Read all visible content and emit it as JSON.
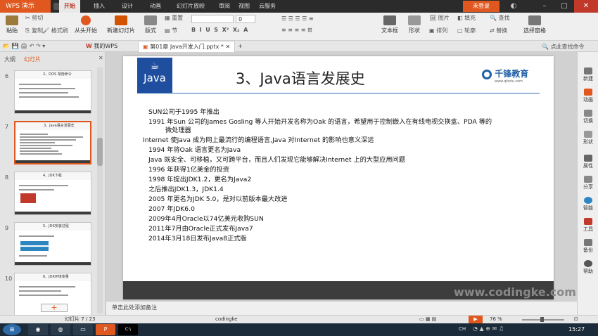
{
  "window": {
    "app_name": "WPS 演示",
    "login_label": "未登录",
    "menu_tabs": [
      "开始",
      "插入",
      "设计",
      "动画",
      "幻灯片放映",
      "审阅",
      "视图",
      "云服务"
    ]
  },
  "ribbon": {
    "paste": "粘贴",
    "cut": "剪切",
    "copy": "复制",
    "format_painter": "格式刷",
    "play_from_start": "从头开始",
    "new_slide": "新建幻灯片",
    "layout": "版式",
    "section": "节",
    "reset": "重置",
    "font_size": "0",
    "find": "查找",
    "replace": "替换",
    "select_pane": "选择窗格",
    "picture": "图片",
    "fill": "填充",
    "arrange": "排列",
    "outline": "轮廓",
    "textbox": "文本框",
    "shape": "形状"
  },
  "doc_tabs": {
    "my_wps": "我的WPS",
    "current_doc": "第01章 Java开发入门.pptx *",
    "search": "点此查找命令"
  },
  "left_pane": {
    "outline_tab": "大纲",
    "slides_tab": "幻灯片",
    "thumbnails": [
      {
        "num": "6",
        "title": "2、DOS 常用命令"
      },
      {
        "num": "7",
        "title": "3、Java语言发展史"
      },
      {
        "num": "8",
        "title": "4、JDK下载"
      },
      {
        "num": "9",
        "title": "5、JDK安装过程"
      },
      {
        "num": "10",
        "title": "6、JDK环境变量"
      }
    ],
    "add_button": "+"
  },
  "slide": {
    "logo_text": "Java",
    "title": "3、Java语言发展史",
    "brand": "千锋教育",
    "brand_url": "www.qfedu.com",
    "bullets": [
      "SUN公司于1995 年推出",
      "1991 年Sun 公司的James Gosling 等人开始开发名称为Oak 的语言，希望用于控制嵌入在有线电视交换盒、PDA 等的",
      "微处理器",
      "Internet 使Java 成为网上最流行的编程语言,Java 对Internet 的影响也意义深远",
      "1994 年将Oak 语言更名为Java",
      "Java 既安全、可移植，又可跨平台，而且人们发现它能够解决Internet 上的大型应用问题",
      "1996 年获得1亿美金的投资",
      "1998 年提出JDK1.2，更名为Java2",
      "之后推出JDK1.3，JDK1.4",
      "2005 年更名为JDK 5.0，是对以前版本最大改进",
      "2007 年JDK6.0",
      "2009年4月Oracle以74亿美元收购SUN",
      "2011年7月由Oracle正式发布Java7",
      "2014年3月18日发布Java8正式版"
    ],
    "watermark": "www.codingke.com 千锋教育"
  },
  "right_pane": [
    "新建",
    "动画",
    "切换",
    "形状",
    "属性",
    "分享",
    "智能",
    "工具",
    "备份",
    "帮助"
  ],
  "notes_placeholder": "单击此处添加备注",
  "status": {
    "slide_counter": "幻灯片 7 / 23",
    "theme": "codingke",
    "zoom": "76 %"
  },
  "taskbar": {
    "time": "15:27",
    "lang": "CH"
  },
  "colors": {
    "accent": "#e0581f",
    "java_blue": "#1f4e9e"
  }
}
